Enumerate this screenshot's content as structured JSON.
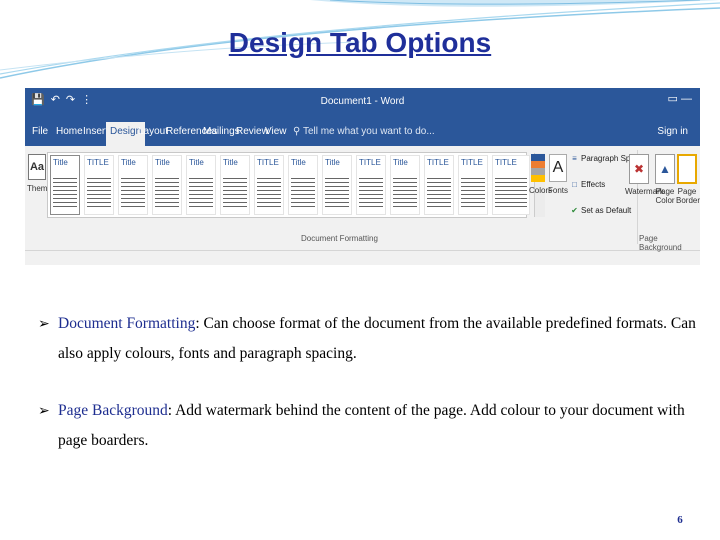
{
  "slide": {
    "title": "Design Tab Options",
    "page_number": "6",
    "accent_color": "#1f2f9a"
  },
  "word_ribbon": {
    "window_title": "Document1 - Word",
    "quick_access_icons": [
      "save-icon",
      "undo-icon",
      "redo-icon",
      "customize-icon"
    ],
    "window_controls": [
      "restore-icon",
      "minimize-icon"
    ],
    "tabs": [
      "File",
      "Home",
      "Insert",
      "Design",
      "Layout",
      "References",
      "Mailings",
      "Review",
      "View"
    ],
    "active_tab": "Design",
    "search_placeholder": "Tell me what you want to do...",
    "sign_in": "Sign in",
    "themes_label": "Themes",
    "style_gallery": [
      "Title",
      "TITLE",
      "Title",
      "Title",
      "Title",
      "Title",
      "TITLE",
      "Title",
      "Title",
      "TITLE",
      "Title",
      "TITLE",
      "TITLE",
      "TITLE"
    ],
    "colors_label": "Colors",
    "fonts_label": "Fonts",
    "paragraph_spacing_label": "Paragraph Spacing",
    "effects_label": "Effects",
    "set_as_default_label": "Set as Default",
    "watermark_label": "Watermark",
    "page_color_label": "Page Color",
    "page_borders_label": "Page Borders",
    "document_formatting_group": "Document Formatting",
    "page_background_group": "Page Background",
    "ribbon_color": "#2b579a"
  },
  "bullets": [
    {
      "term": "Document Formatting",
      "text": ": Can choose format of the document from the available predefined formats. Can also apply colours, fonts and paragraph spacing."
    },
    {
      "term": "Page Background",
      "text": ": Add watermark behind the content of the page. Add colour to your document with page boarders."
    }
  ]
}
